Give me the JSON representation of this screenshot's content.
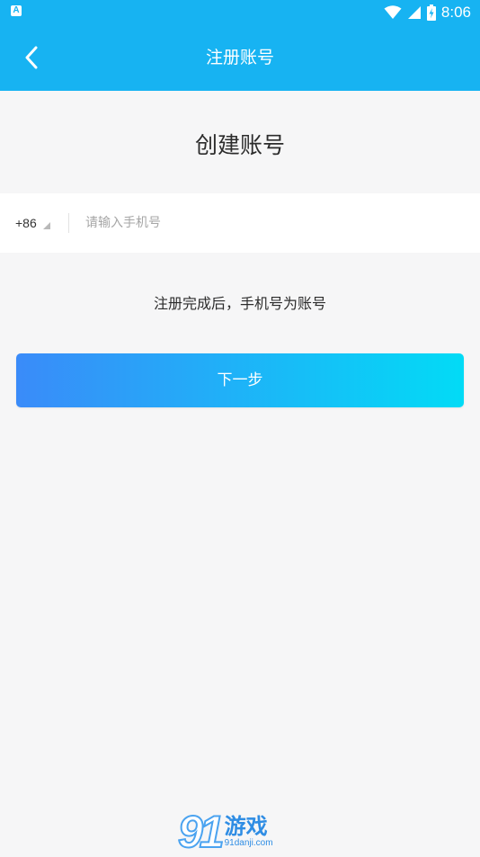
{
  "status_bar": {
    "time": "8:06",
    "app_icon_label": "A",
    "icons": [
      "wifi-icon",
      "signal-icon",
      "battery-charging-icon"
    ]
  },
  "app_bar": {
    "title": "注册账号",
    "back_icon": "chevron-left-icon"
  },
  "main": {
    "heading": "创建账号",
    "country_code": "+86",
    "phone_placeholder": "请输入手机号",
    "phone_value": "",
    "hint": "注册完成后，手机号为账号",
    "next_label": "下一步"
  },
  "watermark": {
    "number": "91",
    "brand": "游戏",
    "url": "91danji.com"
  },
  "colors": {
    "primary": "#17b3f2",
    "gradient_start": "#3a8bf9",
    "gradient_end": "#02dbf6",
    "background": "#f6f6f7"
  }
}
